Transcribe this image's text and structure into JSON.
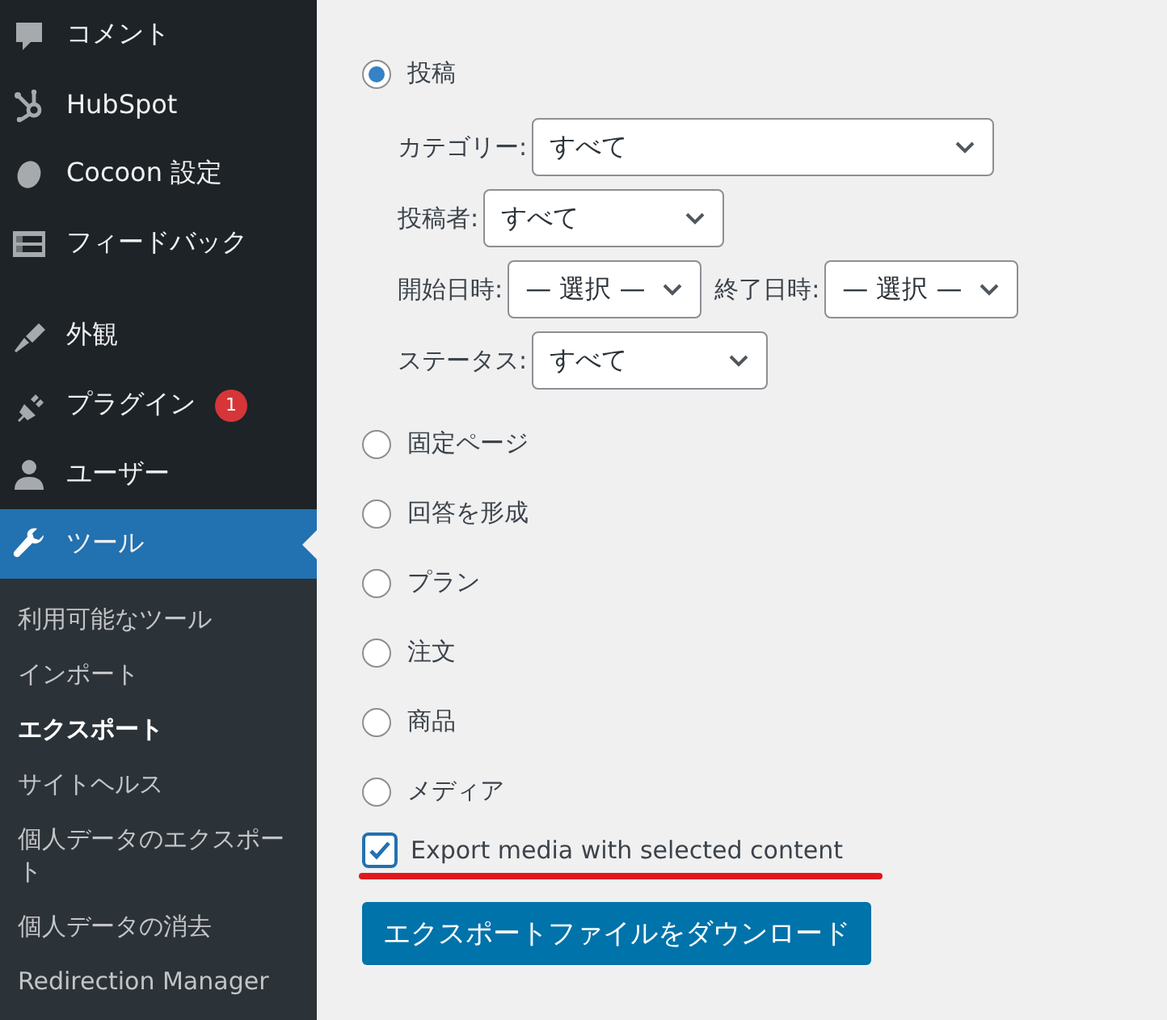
{
  "sidebar": {
    "menu_groups": [
      [
        {
          "label": "コメント",
          "selected": false
        },
        {
          "label": "HubSpot",
          "selected": false
        },
        {
          "label": "Cocoon 設定",
          "selected": false
        },
        {
          "label": "フィードバック",
          "selected": false
        }
      ],
      [
        {
          "label": "外観",
          "selected": false
        },
        {
          "label": "プラグイン",
          "selected": false,
          "badge": "1"
        },
        {
          "label": "ユーザー",
          "selected": false
        },
        {
          "label": "ツール",
          "selected": true
        }
      ]
    ],
    "submenu": [
      {
        "label": "利用可能なツール",
        "selected": false
      },
      {
        "label": "インポート",
        "selected": false
      },
      {
        "label": "エクスポート",
        "selected": true
      },
      {
        "label": "サイトヘルス",
        "selected": false
      },
      {
        "label": "個人データのエクスポート",
        "selected": false
      },
      {
        "label": "個人データの消去",
        "selected": false
      },
      {
        "label": "Redirection Manager",
        "selected": false
      }
    ]
  },
  "export_types": [
    {
      "label": "投稿",
      "selected": true,
      "filters": [
        [
          {
            "label": "カテゴリー:",
            "value": "すべて"
          }
        ],
        [
          {
            "label": "投稿者:",
            "value": "すべて"
          }
        ],
        [
          {
            "label": "開始日時:",
            "value": "— 選択 —"
          },
          {
            "label": "終了日時:",
            "value": "— 選択 —"
          }
        ],
        [
          {
            "label": "ステータス:",
            "value": "すべて"
          }
        ]
      ]
    },
    {
      "label": "固定ページ",
      "selected": false
    },
    {
      "label": "回答を形成",
      "selected": false
    },
    {
      "label": "プラン",
      "selected": false
    },
    {
      "label": "注文",
      "selected": false
    },
    {
      "label": "商品",
      "selected": false
    },
    {
      "label": "メディア",
      "selected": false
    }
  ],
  "media_option": {
    "label": "Export media with selected content",
    "checked": true
  },
  "download_button": {
    "label": "エクスポートファイルをダウンロード"
  }
}
